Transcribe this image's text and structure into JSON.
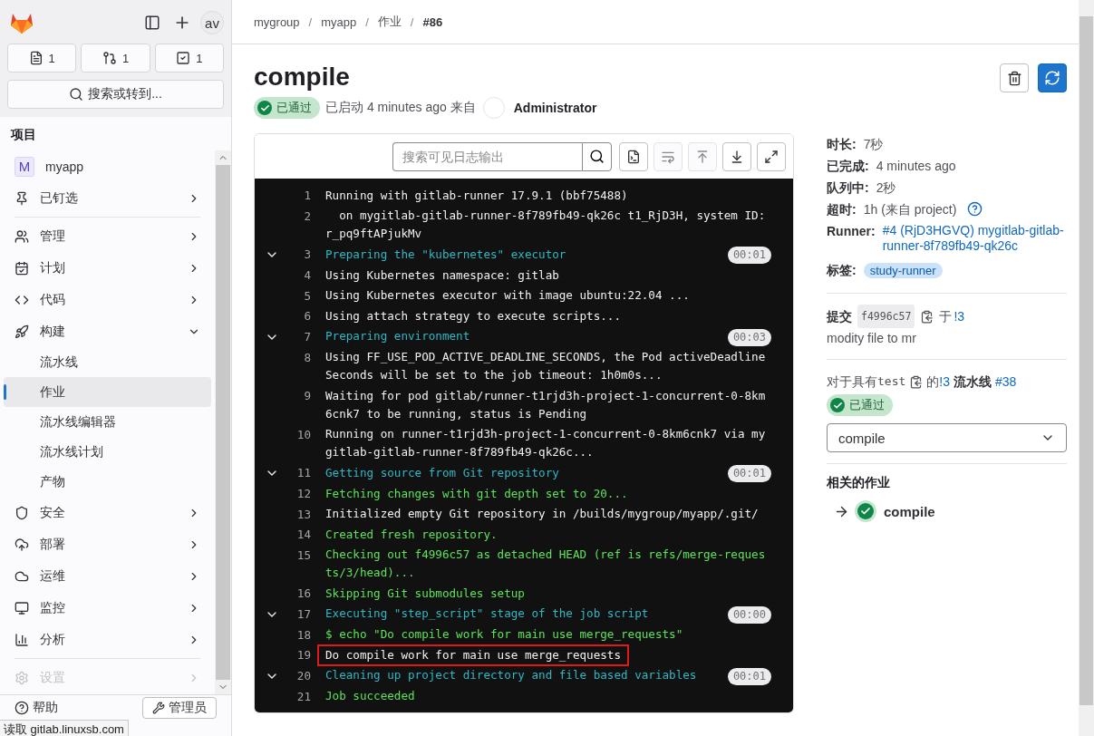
{
  "sidebar": {
    "counters": [
      {
        "count": "1"
      },
      {
        "count": "1"
      },
      {
        "count": "1"
      }
    ],
    "avatar": "av",
    "search": "搜索或转到...",
    "section": "项目",
    "project": {
      "initial": "M",
      "name": "myapp"
    },
    "items": [
      {
        "label": "已钉选",
        "expanded": false,
        "divider_after": true
      },
      {
        "label": "管理",
        "expanded": false
      },
      {
        "label": "计划",
        "expanded": false
      },
      {
        "label": "代码",
        "expanded": false
      },
      {
        "label": "构建",
        "expanded": true,
        "children": [
          {
            "label": "流水线",
            "selected": false
          },
          {
            "label": "作业",
            "selected": true
          },
          {
            "label": "流水线编辑器",
            "selected": false
          },
          {
            "label": "流水线计划",
            "selected": false
          },
          {
            "label": "产物",
            "selected": false
          }
        ]
      },
      {
        "label": "安全",
        "expanded": false
      },
      {
        "label": "部署",
        "expanded": false
      },
      {
        "label": "运维",
        "expanded": false
      },
      {
        "label": "监控",
        "expanded": false
      },
      {
        "label": "分析",
        "expanded": false,
        "divider_after": true
      },
      {
        "label": "设置",
        "expanded": false
      }
    ],
    "footer": {
      "help": "帮助",
      "admin": "管理员"
    }
  },
  "breadcrumb": [
    "mygroup",
    "myapp",
    "作业",
    "#86"
  ],
  "breadcrumb_separator": "/",
  "title": "compile",
  "status": "已通过",
  "started": "已启动 4 minutes ago 来自",
  "user": "Administrator",
  "log": {
    "search_placeholder": "搜索可见日志输出",
    "tools": [
      {
        "disabled": false
      },
      {
        "disabled": true
      },
      {
        "disabled": true
      },
      {
        "disabled": false
      },
      {
        "disabled": false
      }
    ],
    "lines": [
      {
        "number": "1",
        "kind": "plain",
        "text": "Running with gitlab-runner 17.9.1 (bbf75488)",
        "highlighted": false
      },
      {
        "number": "2",
        "kind": "plain",
        "text": "  on mygitlab-gitlab-runner-8f789fb49-qk26c t1_RjD3H, system ID: r_pq9ftAPjukMv",
        "highlighted": false
      },
      {
        "number": "3",
        "kind": "section",
        "text": "Preparing the \"kubernetes\" executor",
        "expanded": true,
        "duration": "00:01",
        "highlighted": false
      },
      {
        "number": "4",
        "kind": "plain",
        "text": "Using Kubernetes namespace: gitlab",
        "highlighted": false
      },
      {
        "number": "5",
        "kind": "plain",
        "text": "Using Kubernetes executor with image ubuntu:22.04 ...",
        "highlighted": false
      },
      {
        "number": "6",
        "kind": "plain",
        "text": "Using attach strategy to execute scripts...",
        "highlighted": false
      },
      {
        "number": "7",
        "kind": "section",
        "text": "Preparing environment",
        "expanded": true,
        "duration": "00:03",
        "highlighted": false
      },
      {
        "number": "8",
        "kind": "plain",
        "text": "Using FF_USE_POD_ACTIVE_DEADLINE_SECONDS, the Pod activeDeadlineSeconds will be set to the job timeout: 1h0m0s...",
        "highlighted": false
      },
      {
        "number": "9",
        "kind": "plain",
        "text": "Waiting for pod gitlab/runner-t1rjd3h-project-1-concurrent-0-8km6cnk7 to be running, status is Pending",
        "highlighted": false
      },
      {
        "number": "10",
        "kind": "plain",
        "text": "Running on runner-t1rjd3h-project-1-concurrent-0-8km6cnk7 via mygitlab-gitlab-runner-8f789fb49-qk26c...",
        "highlighted": false
      },
      {
        "number": "11",
        "kind": "section",
        "text": "Getting source from Git repository",
        "expanded": true,
        "duration": "00:01",
        "highlighted": false
      },
      {
        "number": "12",
        "kind": "success",
        "text": "Fetching changes with git depth set to 20...",
        "highlighted": false
      },
      {
        "number": "13",
        "kind": "plain",
        "text": "Initialized empty Git repository in /builds/mygroup/myapp/.git/",
        "highlighted": false
      },
      {
        "number": "14",
        "kind": "success",
        "text": "Created fresh repository.",
        "highlighted": false
      },
      {
        "number": "15",
        "kind": "success",
        "text": "Checking out f4996c57 as detached HEAD (ref is refs/merge-requests/3/head)...",
        "highlighted": false
      },
      {
        "number": "16",
        "kind": "success",
        "text": "Skipping Git submodules setup",
        "highlighted": false
      },
      {
        "number": "17",
        "kind": "section",
        "text": "Executing \"step_script\" stage of the job script",
        "expanded": true,
        "duration": "00:00",
        "highlighted": false
      },
      {
        "number": "18",
        "kind": "success",
        "text": "$ echo \"Do compile work for main use merge_requests\"",
        "highlighted": false
      },
      {
        "number": "19",
        "kind": "plain",
        "text": "Do compile work for main use merge_requests",
        "highlighted": true
      },
      {
        "number": "20",
        "kind": "section",
        "text": "Cleaning up project directory and file based variables",
        "expanded": true,
        "duration": "00:01",
        "highlighted": false
      },
      {
        "number": "21",
        "kind": "success",
        "text": "Job succeeded",
        "highlighted": false
      }
    ]
  },
  "details": [
    {
      "label": "时长:",
      "value": "7秒",
      "help": false
    },
    {
      "label": "已完成:",
      "value": "4 minutes ago",
      "help": false
    },
    {
      "label": "队列中:",
      "value": "2秒",
      "help": false
    },
    {
      "label": "超时:",
      "value": "1h (来自 project)",
      "help": true
    }
  ],
  "runner": {
    "label": "Runner:",
    "value": "#4 (RjD3HGVQ) mygitlab-gitlab-runner-8f789fb49-qk26c"
  },
  "tags": {
    "label": "标签:",
    "items": [
      "study-runner"
    ]
  },
  "commit": {
    "label": "提交",
    "sha": "f4996c57",
    "prep": "于",
    "mr": "!3",
    "message": "modity file to mr"
  },
  "pipeline": {
    "prefix": "对于具有",
    "ref": "test",
    "mid": "的",
    "mr": "!3",
    "label": "流水线",
    "number": "#38",
    "status": "已通过",
    "job": "compile"
  },
  "related": {
    "title": "相关的作业",
    "jobs": [
      {
        "name": "compile"
      }
    ]
  },
  "status_bar": "读取 gitlab.linuxsb.com"
}
